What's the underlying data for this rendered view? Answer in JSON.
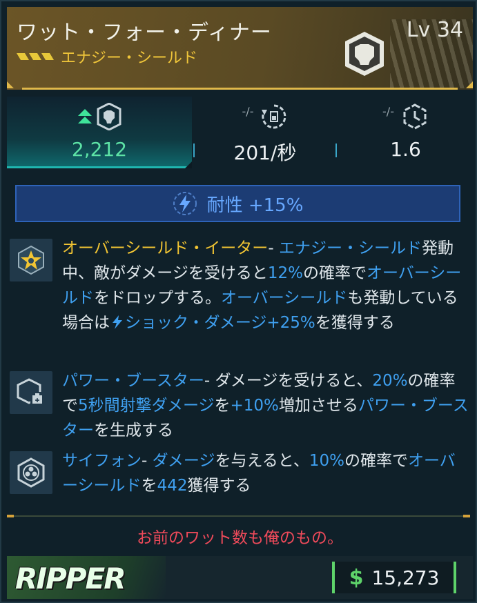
{
  "item": {
    "title": "ワット・フォー・ディナー",
    "subtitle": "エナジー・シールド",
    "level": "Lv 34",
    "rarity_color": "#e0b84a"
  },
  "stats": [
    {
      "icon": "shield-capacity-icon",
      "value": "2,212",
      "compare": "",
      "value_color": "#5de3a6"
    },
    {
      "icon": "shield-recharge-rate-icon",
      "value": "201/秒",
      "compare": "-/-"
    },
    {
      "icon": "shield-recharge-delay-icon",
      "value": "1.6",
      "compare": "-/-"
    }
  ],
  "resistance": {
    "icon": "shock-icon",
    "label": "耐性 +15%",
    "color": "#67a8ff"
  },
  "perks": [
    {
      "icon": "overshield-eater-icon",
      "name": "オーバーシールド・イーター",
      "dash": "- ",
      "segments": [
        "エナジー・シールド",
        "発動中、敵がダメージを受けると",
        "12%",
        "の確率で",
        "オーバーシールド",
        "をドロップする。",
        "オーバーシールド",
        "も発動している場合は",
        "ショック・ダメージ",
        "+25%",
        "を獲得する"
      ]
    },
    {
      "icon": "power-booster-icon",
      "name": "パワー・ブースター",
      "dash": "- ",
      "segments": [
        "ダメージを受けると、",
        "20%",
        "の確率で",
        "5秒間射撃ダメージ",
        "を",
        "+10%",
        "増加させる",
        "パワー・ブースター",
        "を生成する"
      ]
    },
    {
      "icon": "siphon-icon",
      "name": "サイフォン",
      "dash": "- ",
      "segments": [
        "ダメージ",
        "を与えると、",
        "10%",
        "の確率で",
        "オーバーシールド",
        "を",
        "442",
        "獲得する"
      ]
    }
  ],
  "flavor_text": "お前のワット数も俺のもの。",
  "manufacturer": "RIPPER",
  "price": "15,273",
  "currency_symbol": "$"
}
